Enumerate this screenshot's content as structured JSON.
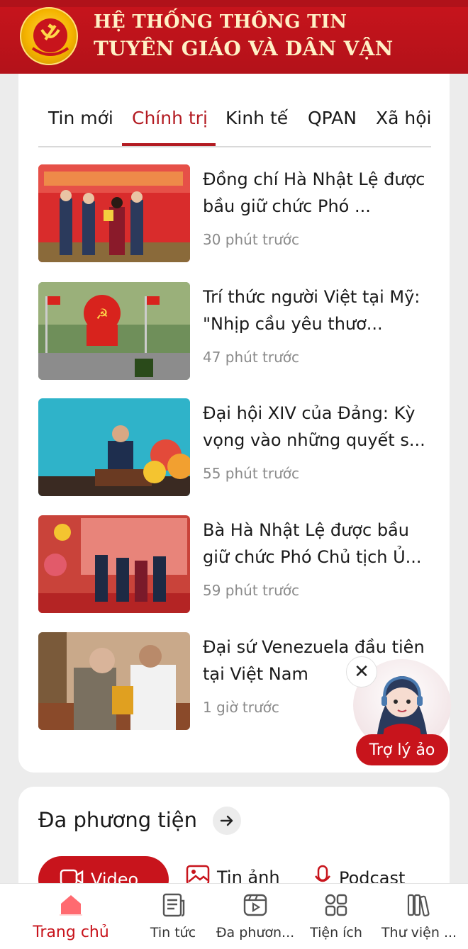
{
  "header": {
    "line1": "HỆ THỐNG THÔNG TIN",
    "line2": "TUYÊN GIÁO VÀ DÂN VẬN",
    "brand_color": "#c8141c",
    "emblem_icon": "party-emblem-icon"
  },
  "news": {
    "tabs": [
      "Tin mới",
      "Chính trị",
      "Kinh tế",
      "QPAN",
      "Xã hội"
    ],
    "active_tab": "Chính trị",
    "articles": [
      {
        "title": "Đồng chí Hà Nhật Lệ được bầu giữ chức Phó ...",
        "time": "30 phút trước"
      },
      {
        "title": "Trí thức người Việt tại Mỹ: \"Nhịp cầu yêu thươ...",
        "time": "47 phút trước"
      },
      {
        "title": "Đại hội XIV của Đảng: Kỳ vọng vào những quyết s...",
        "time": "55 phút trước"
      },
      {
        "title": "Bà Hà Nhật Lệ được bầu giữ chức Phó Chủ tịch Ủ...",
        "time": "59 phút trước"
      },
      {
        "title": "Đại sứ Venezuela đầu tiên tại Việt Nam",
        "time": "1 giờ trước"
      }
    ]
  },
  "assistant": {
    "label": "Trợ lý ảo",
    "close_symbol": "✕"
  },
  "media": {
    "title": "Đa phương tiện",
    "tabs": [
      {
        "label": "Video",
        "icon": "video-camera-icon",
        "active": true
      },
      {
        "label": "Tin ảnh",
        "icon": "image-icon",
        "active": false
      },
      {
        "label": "Podcast",
        "icon": "microphone-icon",
        "active": false
      }
    ]
  },
  "bottom_nav": [
    {
      "label": "Trang chủ",
      "icon": "home-icon",
      "active": true
    },
    {
      "label": "Tin tức",
      "icon": "news-icon",
      "active": false
    },
    {
      "label": "Đa phươn...",
      "icon": "media-icon",
      "active": false
    },
    {
      "label": "Tiện ích",
      "icon": "apps-icon",
      "active": false
    },
    {
      "label": "Thư viện ...",
      "icon": "library-icon",
      "active": false
    }
  ]
}
